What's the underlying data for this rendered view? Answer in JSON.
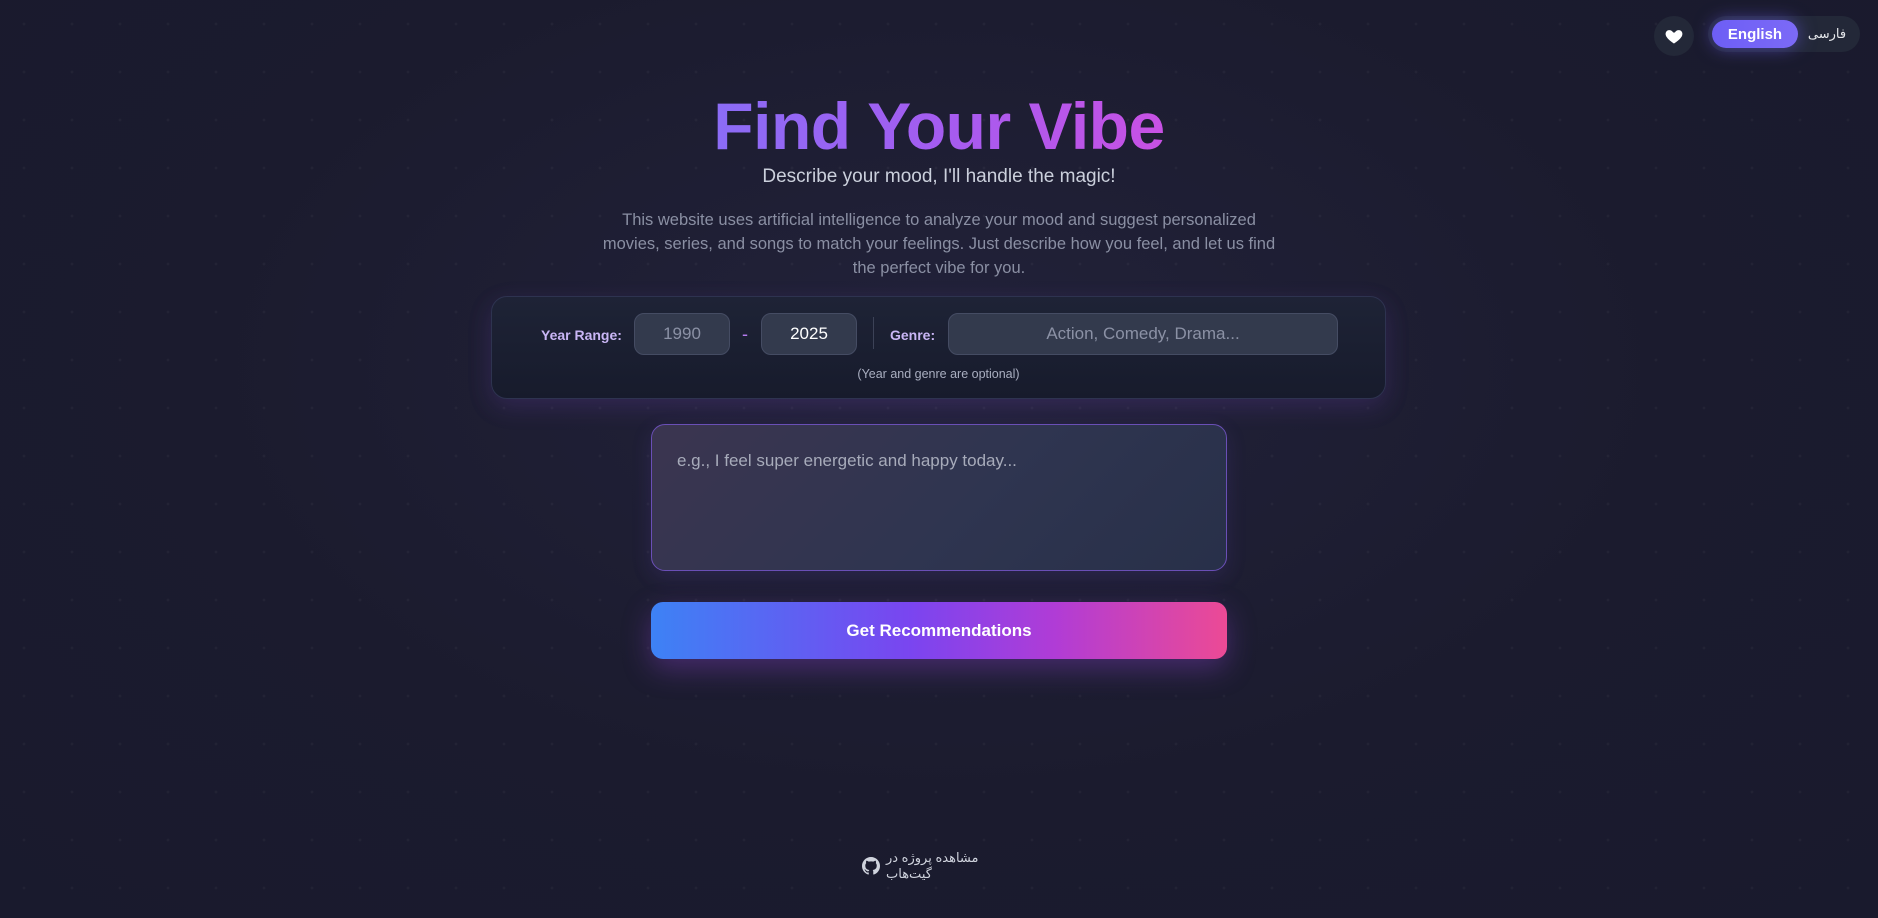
{
  "header": {
    "favorites_icon": "heart-icon",
    "languages": [
      {
        "label": "English",
        "active": true
      },
      {
        "label": "فارسی",
        "active": false
      }
    ]
  },
  "hero": {
    "title": "Find Your Vibe",
    "subtitle": "Describe your mood, I'll handle the magic!",
    "description": "This website uses artificial intelligence to analyze your mood and suggest personalized movies, series, and songs to match your feelings. Just describe how you feel, and let us find the perfect vibe for you."
  },
  "filters": {
    "year_range_label": "Year Range:",
    "year_from_placeholder": "1990",
    "year_from_value": "",
    "range_separator": "-",
    "year_to_value": "2025",
    "genre_label": "Genre:",
    "genre_placeholder": "Action, Comedy, Drama...",
    "note": "(Year and genre are optional)"
  },
  "mood": {
    "placeholder": "e.g., I feel super energetic and happy today..."
  },
  "cta": {
    "label": "Get Recommendations"
  },
  "footer": {
    "github_icon": "github-icon",
    "link_label": "مشاهده پروژه در گیت‌هاب"
  },
  "colors": {
    "background": "#1b1b2e",
    "accent_purple": "#8b6cf6",
    "accent_pink": "#ec4a95",
    "accent_blue": "#3d82f5"
  }
}
